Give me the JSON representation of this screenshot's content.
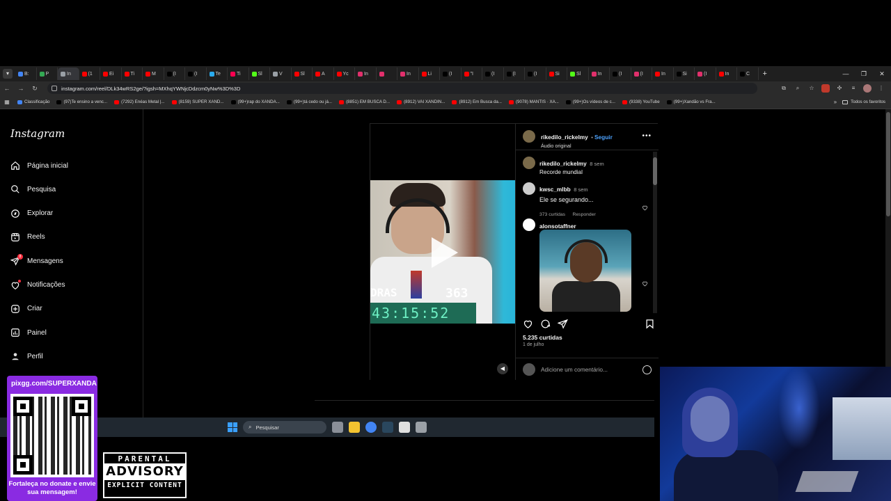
{
  "browser": {
    "tab_colors": [
      "#4285f4",
      "#34a853",
      "#9aa0a6",
      "#ff0000",
      "#ff0000",
      "#ff0000",
      "#ff0000",
      "#000000",
      "#000000",
      "#2aabee",
      "#ff0050",
      "#53fc18",
      "#9aa0a6",
      "#ff0000",
      "#ff0000",
      "#ff0000",
      "#e1306c",
      "#e1306c",
      "#e1306c",
      "#ff0000",
      "#000000",
      "#ff0000",
      "#000000",
      "#000000",
      "#000000",
      "#ff0000",
      "#53fc18",
      "#e1306c",
      "#000000",
      "#e1306c",
      "#ff0000",
      "#000000",
      "#e1306c",
      "#ff0000",
      "#000000"
    ],
    "tabs": [
      "B:",
      "P",
      "In",
      "(1",
      "Ei",
      "Ti",
      "M",
      "(I",
      "(I",
      "Te",
      "Ti",
      "Sl",
      "V",
      "Sl",
      "A",
      "Yc",
      "In",
      "",
      "In",
      "Li",
      "(I",
      "\"I",
      "(I",
      "(I",
      "(I",
      "Si",
      "Sl",
      "In",
      "(I",
      "(I",
      "In",
      "Si",
      "(I",
      "In",
      "C"
    ],
    "active_tab_index": 2,
    "url": "instagram.com/reel/DLk34wRS2ge/?igsh=MXhqYWNjcDdzcm0yNw%3D%3D",
    "bookmarks": [
      {
        "label": "Classificação",
        "color": "#4285f4"
      },
      {
        "label": "(97)Te ensino a venc...",
        "color": "#000000"
      },
      {
        "label": "(7292) Enéas Metal |...",
        "color": "#ff0000"
      },
      {
        "label": "(8159) SUPER XAND...",
        "color": "#ff0000"
      },
      {
        "label": "(99+)rap do XANDÃ...",
        "color": "#000000"
      },
      {
        "label": "(99+)tá cedo ou já...",
        "color": "#000000"
      },
      {
        "label": "(8851) EM BUSCA D...",
        "color": "#ff0000"
      },
      {
        "label": "(8912) VAI XANDIN...",
        "color": "#ff0000"
      },
      {
        "label": "(8912) Em Busca da...",
        "color": "#ff0000"
      },
      {
        "label": "(9078) MANTIS · XA...",
        "color": "#ff0000"
      },
      {
        "label": "(99+)Os vídeos de c...",
        "color": "#000000"
      },
      {
        "label": "(9338) YouTube",
        "color": "#ff0000"
      },
      {
        "label": "(99+)Xandão vs Fra...",
        "color": "#000000"
      }
    ],
    "bookmarks_folder": "Todos os favoritos"
  },
  "instagram": {
    "logo": "Instagram",
    "nav": [
      {
        "label": "Página inicial",
        "icon": "home-icon"
      },
      {
        "label": "Pesquisa",
        "icon": "search-icon"
      },
      {
        "label": "Explorar",
        "icon": "compass-icon"
      },
      {
        "label": "Reels",
        "icon": "reels-icon"
      },
      {
        "label": "Mensagens",
        "icon": "messages-icon",
        "badge": "8"
      },
      {
        "label": "Notificações",
        "icon": "heart-icon"
      },
      {
        "label": "Criar",
        "icon": "plus-icon"
      },
      {
        "label": "Painel",
        "icon": "dashboard-icon"
      },
      {
        "label": "Perfil",
        "icon": "profile-icon"
      }
    ],
    "reel": {
      "video_overlay_text": "DRAS",
      "video_number": "363",
      "video_timer": "43:15:52",
      "author": "rikedilo_rickelmy",
      "follow_label": "Seguir",
      "audio": "Áudio original",
      "caption_user": "rikedilo_rickelmy",
      "caption_time": "8 sem",
      "caption_text": "Recorde mundial",
      "comments": [
        {
          "user": "kwsc_mlbb",
          "time": "8 sem",
          "text": "Ele se segurando...",
          "likes": "373 curtidas",
          "reply": "Responder"
        },
        {
          "user": "alonsotaffner"
        }
      ],
      "likes": "5.235 curtidas",
      "date": "1 de julho",
      "add_comment_placeholder": "Adicione um comentário..."
    }
  },
  "taskbar": {
    "search_label": "Pesquisar",
    "app_colors": [
      "#8a8f98",
      "#f4c430",
      "#4285f4",
      "#2a475e",
      "#e0e0e0",
      "#9aa0a6"
    ]
  },
  "overlays": {
    "donate_url": "pixgg.com/SUPERXANDA",
    "donate_caption": "Fortaleça no donate e envie sua mensagem!",
    "advisory_top": "PARENTAL",
    "advisory_mid": "ADVISORY",
    "advisory_bottom": "EXPLICIT CONTENT"
  }
}
